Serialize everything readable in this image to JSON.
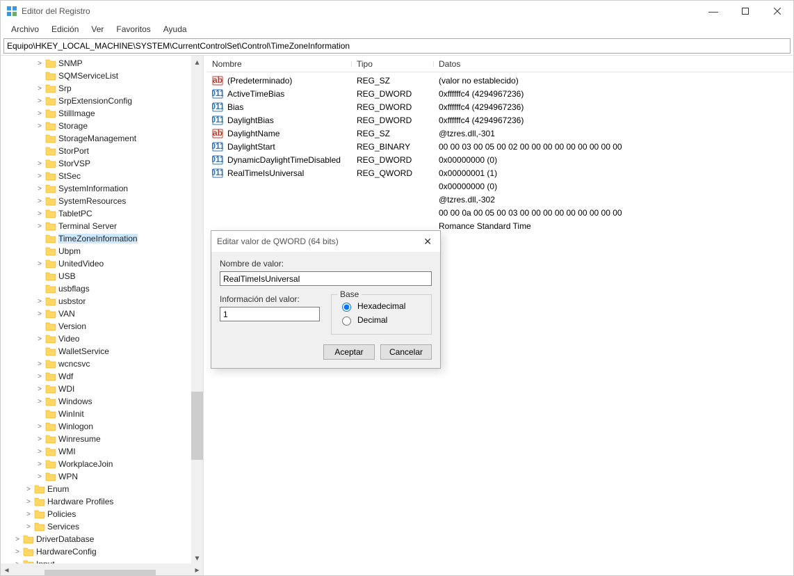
{
  "window": {
    "title": "Editor del Registro",
    "minimize": "—",
    "maximize": "□",
    "close": "✕"
  },
  "menu": [
    "Archivo",
    "Edición",
    "Ver",
    "Favoritos",
    "Ayuda"
  ],
  "address": "Equipo\\HKEY_LOCAL_MACHINE\\SYSTEM\\CurrentControlSet\\Control\\TimeZoneInformation",
  "columns": {
    "name": "Nombre",
    "type": "Tipo",
    "data": "Datos"
  },
  "tree": [
    {
      "indent": 3,
      "exp": ">",
      "label": "SNMP"
    },
    {
      "indent": 3,
      "exp": "",
      "label": "SQMServiceList"
    },
    {
      "indent": 3,
      "exp": ">",
      "label": "Srp"
    },
    {
      "indent": 3,
      "exp": ">",
      "label": "SrpExtensionConfig"
    },
    {
      "indent": 3,
      "exp": ">",
      "label": "StillImage"
    },
    {
      "indent": 3,
      "exp": ">",
      "label": "Storage"
    },
    {
      "indent": 3,
      "exp": "",
      "label": "StorageManagement"
    },
    {
      "indent": 3,
      "exp": "",
      "label": "StorPort"
    },
    {
      "indent": 3,
      "exp": ">",
      "label": "StorVSP"
    },
    {
      "indent": 3,
      "exp": ">",
      "label": "StSec"
    },
    {
      "indent": 3,
      "exp": ">",
      "label": "SystemInformation"
    },
    {
      "indent": 3,
      "exp": ">",
      "label": "SystemResources"
    },
    {
      "indent": 3,
      "exp": ">",
      "label": "TabletPC"
    },
    {
      "indent": 3,
      "exp": ">",
      "label": "Terminal Server"
    },
    {
      "indent": 3,
      "exp": "",
      "label": "TimeZoneInformation",
      "selected": true
    },
    {
      "indent": 3,
      "exp": "",
      "label": "Ubpm"
    },
    {
      "indent": 3,
      "exp": ">",
      "label": "UnitedVideo"
    },
    {
      "indent": 3,
      "exp": "",
      "label": "USB"
    },
    {
      "indent": 3,
      "exp": "",
      "label": "usbflags"
    },
    {
      "indent": 3,
      "exp": ">",
      "label": "usbstor"
    },
    {
      "indent": 3,
      "exp": ">",
      "label": "VAN"
    },
    {
      "indent": 3,
      "exp": "",
      "label": "Version"
    },
    {
      "indent": 3,
      "exp": ">",
      "label": "Video"
    },
    {
      "indent": 3,
      "exp": "",
      "label": "WalletService"
    },
    {
      "indent": 3,
      "exp": ">",
      "label": "wcncsvc"
    },
    {
      "indent": 3,
      "exp": ">",
      "label": "Wdf"
    },
    {
      "indent": 3,
      "exp": ">",
      "label": "WDI"
    },
    {
      "indent": 3,
      "exp": ">",
      "label": "Windows"
    },
    {
      "indent": 3,
      "exp": "",
      "label": "WinInit"
    },
    {
      "indent": 3,
      "exp": ">",
      "label": "Winlogon"
    },
    {
      "indent": 3,
      "exp": ">",
      "label": "Winresume"
    },
    {
      "indent": 3,
      "exp": ">",
      "label": "WMI"
    },
    {
      "indent": 3,
      "exp": ">",
      "label": "WorkplaceJoin"
    },
    {
      "indent": 3,
      "exp": ">",
      "label": "WPN"
    },
    {
      "indent": 2,
      "exp": ">",
      "label": "Enum"
    },
    {
      "indent": 2,
      "exp": ">",
      "label": "Hardware Profiles"
    },
    {
      "indent": 2,
      "exp": ">",
      "label": "Policies"
    },
    {
      "indent": 2,
      "exp": ">",
      "label": "Services"
    },
    {
      "indent": 1,
      "exp": ">",
      "label": "DriverDatabase"
    },
    {
      "indent": 1,
      "exp": ">",
      "label": "HardwareConfig"
    },
    {
      "indent": 1,
      "exp": ">",
      "label": "Input"
    }
  ],
  "values": [
    {
      "icon": "sz",
      "name": "(Predeterminado)",
      "type": "REG_SZ",
      "data": "(valor no establecido)"
    },
    {
      "icon": "bin",
      "name": "ActiveTimeBias",
      "type": "REG_DWORD",
      "data": "0xffffffc4 (4294967236)"
    },
    {
      "icon": "bin",
      "name": "Bias",
      "type": "REG_DWORD",
      "data": "0xffffffc4 (4294967236)"
    },
    {
      "icon": "bin",
      "name": "DaylightBias",
      "type": "REG_DWORD",
      "data": "0xffffffc4 (4294967236)"
    },
    {
      "icon": "sz",
      "name": "DaylightName",
      "type": "REG_SZ",
      "data": "@tzres.dll,-301"
    },
    {
      "icon": "bin",
      "name": "DaylightStart",
      "type": "REG_BINARY",
      "data": "00 00 03 00 05 00 02 00 00 00 00 00 00 00 00 00"
    },
    {
      "icon": "bin",
      "name": "DynamicDaylightTimeDisabled",
      "type": "REG_DWORD",
      "data": "0x00000000 (0)"
    },
    {
      "icon": "bin",
      "name": "RealTimeIsUniversal",
      "type": "REG_QWORD",
      "data": "0x00000001 (1)"
    },
    {
      "icon": "_hidden",
      "name": "",
      "type": "",
      "data": "0x00000000 (0)"
    },
    {
      "icon": "_hidden",
      "name": "",
      "type": "",
      "data": "@tzres.dll,-302"
    },
    {
      "icon": "_hidden",
      "name": "",
      "type": "",
      "data": "00 00 0a 00 05 00 03 00 00 00 00 00 00 00 00 00"
    },
    {
      "icon": "_hidden",
      "name": "",
      "type": "",
      "data": "Romance Standard Time"
    }
  ],
  "dialog": {
    "title": "Editar valor de QWORD (64 bits)",
    "close": "✕",
    "name_label": "Nombre de valor:",
    "name_value": "RealTimeIsUniversal",
    "data_label": "Información del valor:",
    "data_value": "1",
    "base_label": "Base",
    "hex": "Hexadecimal",
    "dec": "Decimal",
    "ok": "Aceptar",
    "cancel": "Cancelar"
  }
}
